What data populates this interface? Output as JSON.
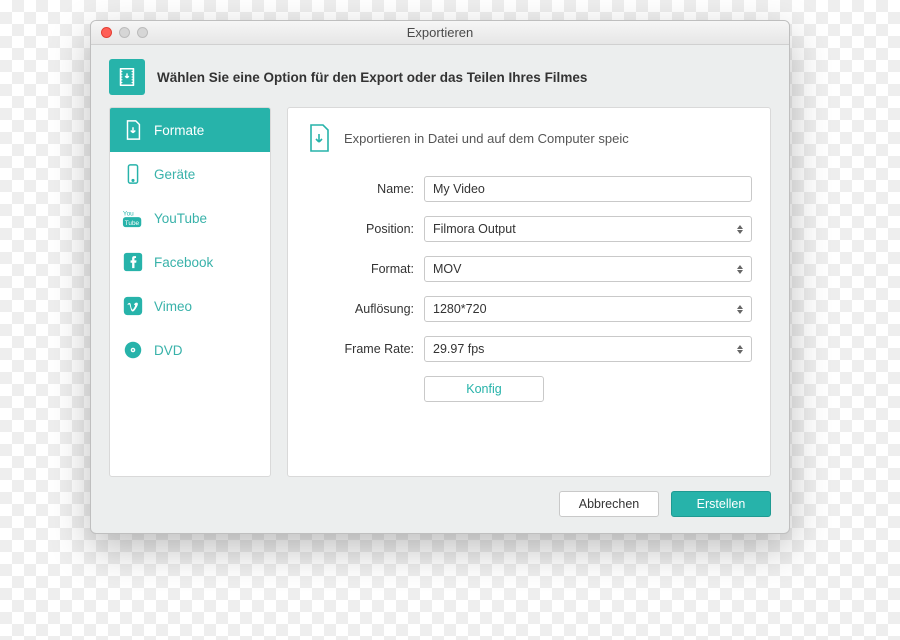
{
  "window": {
    "title": "Exportieren"
  },
  "header": {
    "text": "Wählen Sie eine Option für den Export oder das Teilen Ihres Filmes"
  },
  "sidebar": {
    "items": [
      {
        "id": "formats",
        "label": "Formate",
        "active": true
      },
      {
        "id": "devices",
        "label": "Geräte",
        "active": false
      },
      {
        "id": "youtube",
        "label": "YouTube",
        "active": false
      },
      {
        "id": "facebook",
        "label": "Facebook",
        "active": false
      },
      {
        "id": "vimeo",
        "label": "Vimeo",
        "active": false
      },
      {
        "id": "dvd",
        "label": "DVD",
        "active": false
      }
    ]
  },
  "panel": {
    "heading": "Exportieren in Datei und auf dem Computer speic",
    "fields": {
      "name": {
        "label": "Name:",
        "value": "My Video"
      },
      "position": {
        "label": "Position:",
        "value": "Filmora Output"
      },
      "format": {
        "label": "Format:",
        "value": "MOV"
      },
      "resolution": {
        "label": "Auflösung:",
        "value": "1280*720"
      },
      "framerate": {
        "label": "Frame Rate:",
        "value": "29.97 fps"
      }
    },
    "config_button": "Konfig"
  },
  "footer": {
    "cancel": "Abbrechen",
    "create": "Erstellen"
  }
}
